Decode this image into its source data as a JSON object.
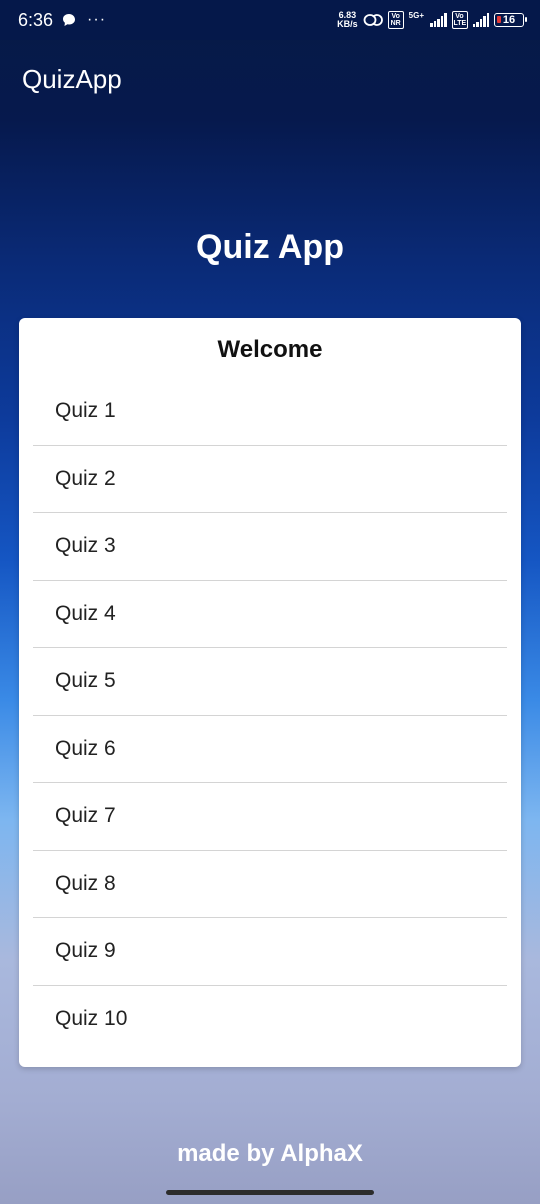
{
  "status_bar": {
    "time": "6:36",
    "network_speed_value": "6.83",
    "network_speed_unit": "KB/s",
    "sim1_label": "5G+",
    "battery_level": "16",
    "icons": [
      "chat-icon",
      "more-dots-icon",
      "link-icon",
      "volte-icon",
      "signal-icon",
      "battery-icon"
    ]
  },
  "app_bar": {
    "title": "QuizApp"
  },
  "hero": {
    "title": "Quiz App"
  },
  "card": {
    "title": "Welcome",
    "items": [
      {
        "label": "Quiz 1"
      },
      {
        "label": "Quiz 2"
      },
      {
        "label": "Quiz 3"
      },
      {
        "label": "Quiz 4"
      },
      {
        "label": "Quiz 5"
      },
      {
        "label": "Quiz 6"
      },
      {
        "label": "Quiz 7"
      },
      {
        "label": "Quiz 8"
      },
      {
        "label": "Quiz 9"
      },
      {
        "label": "Quiz 10"
      }
    ]
  },
  "footer": {
    "text": "made by AlphaX"
  },
  "colors": {
    "status_bar_bg": "#05184a",
    "card_bg": "#ffffff",
    "text_on_dark": "#ffffff",
    "battery_low": "#e53935"
  }
}
